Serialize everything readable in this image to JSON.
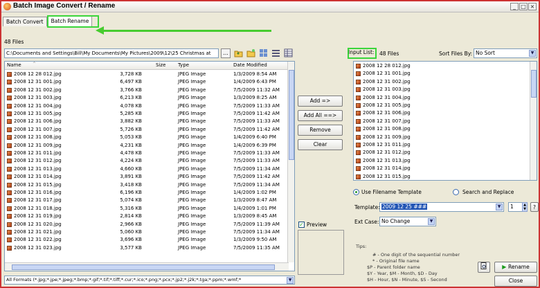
{
  "window": {
    "title": "Batch Image Convert / Rename",
    "controls": [
      "_",
      "□",
      "×"
    ]
  },
  "tabs": [
    {
      "label": "Batch Convert"
    },
    {
      "label": "Batch Rename"
    }
  ],
  "left": {
    "file_count": "48 Files",
    "path": "C:\\Documents and Settings\\Bill\\My Documents\\My Pictures\\2009\\12\\25 Christmas at",
    "browse_label": "...",
    "columns": {
      "name": "Name",
      "size": "Size",
      "type": "Type",
      "date": "Date Modified"
    },
    "rows": [
      {
        "name": "2008 12 28 012.jpg",
        "size": "3,728 KB",
        "type": "JPEG Image",
        "date": "1/3/2009 8:54 AM"
      },
      {
        "name": "2008 12 31 001.jpg",
        "size": "6,497 KB",
        "type": "JPEG Image",
        "date": "1/4/2009 6:43 PM"
      },
      {
        "name": "2008 12 31 002.jpg",
        "size": "3,766 KB",
        "type": "JPEG Image",
        "date": "7/5/2009 11:32 AM"
      },
      {
        "name": "2008 12 31 003.jpg",
        "size": "6,213 KB",
        "type": "JPEG Image",
        "date": "1/3/2009 8:25 AM"
      },
      {
        "name": "2008 12 31 004.jpg",
        "size": "4,078 KB",
        "type": "JPEG Image",
        "date": "7/5/2009 11:33 AM"
      },
      {
        "name": "2008 12 31 005.jpg",
        "size": "5,285 KB",
        "type": "JPEG Image",
        "date": "7/5/2009 11:42 AM"
      },
      {
        "name": "2008 12 31 006.jpg",
        "size": "3,882 KB",
        "type": "JPEG Image",
        "date": "7/5/2009 11:33 AM"
      },
      {
        "name": "2008 12 31 007.jpg",
        "size": "5,726 KB",
        "type": "JPEG Image",
        "date": "7/5/2009 11:42 AM"
      },
      {
        "name": "2008 12 31 008.jpg",
        "size": "5,053 KB",
        "type": "JPEG Image",
        "date": "1/4/2009 6:40 PM"
      },
      {
        "name": "2008 12 31 009.jpg",
        "size": "4,231 KB",
        "type": "JPEG Image",
        "date": "1/4/2009 6:39 PM"
      },
      {
        "name": "2008 12 31 011.jpg",
        "size": "4,478 KB",
        "type": "JPEG Image",
        "date": "7/5/2009 11:33 AM"
      },
      {
        "name": "2008 12 31 012.jpg",
        "size": "4,224 KB",
        "type": "JPEG Image",
        "date": "7/5/2009 11:33 AM"
      },
      {
        "name": "2008 12 31 013.jpg",
        "size": "4,660 KB",
        "type": "JPEG Image",
        "date": "7/5/2009 11:34 AM"
      },
      {
        "name": "2008 12 31 014.jpg",
        "size": "3,891 KB",
        "type": "JPEG Image",
        "date": "7/5/2009 11:42 AM"
      },
      {
        "name": "2008 12 31 015.jpg",
        "size": "3,418 KB",
        "type": "JPEG Image",
        "date": "7/5/2009 11:34 AM"
      },
      {
        "name": "2008 12 31 016.jpg",
        "size": "6,196 KB",
        "type": "JPEG Image",
        "date": "1/4/2009 1:02 PM"
      },
      {
        "name": "2008 12 31 017.jpg",
        "size": "5,074 KB",
        "type": "JPEG Image",
        "date": "1/3/2009 8:47 AM"
      },
      {
        "name": "2008 12 31 018.jpg",
        "size": "5,316 KB",
        "type": "JPEG Image",
        "date": "1/4/2009 1:01 PM"
      },
      {
        "name": "2008 12 31 019.jpg",
        "size": "2,814 KB",
        "type": "JPEG Image",
        "date": "1/3/2009 8:45 AM"
      },
      {
        "name": "2008 12 31 020.jpg",
        "size": "2,966 KB",
        "type": "JPEG Image",
        "date": "7/5/2009 11:39 AM"
      },
      {
        "name": "2008 12 31 021.jpg",
        "size": "5,060 KB",
        "type": "JPEG Image",
        "date": "7/5/2009 11:34 AM"
      },
      {
        "name": "2008 12 31 022.jpg",
        "size": "3,696 KB",
        "type": "JPEG Image",
        "date": "1/3/2009 9:50 AM"
      },
      {
        "name": "2008 12 31 023.jpg",
        "size": "3,577 KB",
        "type": "JPEG Image",
        "date": "7/5/2009 11:35 AM"
      }
    ],
    "format_filter": "All Formats (*.jpg;*.jpe;*.jpeg;*.bmp;*.gif;*.tif;*.tiff;*.cur;*.ico;*.png;*.pcx;*.jp2;*.j2k;*.tga;*.ppm;*.wmf;*"
  },
  "buttons": {
    "add": "Add =>",
    "add_all": "Add All ==>",
    "remove": "Remove",
    "clear": "Clear",
    "rename": "Rename",
    "close": "Close"
  },
  "right": {
    "input_list_label": "Input List:",
    "file_count": "48 Files",
    "sort_label": "Sort Files By:",
    "sort_value": "No Sort",
    "files": [
      "2008 12 28 012.jpg",
      "2008 12 31 001.jpg",
      "2008 12 31 002.jpg",
      "2008 12 31 003.jpg",
      "2008 12 31 004.jpg",
      "2008 12 31 005.jpg",
      "2008 12 31 006.jpg",
      "2008 12 31 007.jpg",
      "2008 12 31 008.jpg",
      "2008 12 31 009.jpg",
      "2008 12 31 011.jpg",
      "2008 12 31 012.jpg",
      "2008 12 31 013.jpg",
      "2008 12 31 014.jpg",
      "2008 12 31 015.jpg"
    ],
    "use_template": "Use Filename Template",
    "search_replace": "Search and Replace",
    "template_label": "Template:",
    "template_value": "2009 12 25 ###",
    "start_number": "1",
    "help": "?",
    "ext_case_label": "Ext Case:",
    "ext_case_value": "No Change",
    "preview_label": "Preview",
    "tips_title": "Tips:",
    "tips": [
      "#  - One digit of the sequential number",
      "*  - Original file name",
      "$P - Parent folder name",
      "$Y - Year,    $M - Month,     $D - Day",
      "$H - Hour,    $N - Minute,    $S - Second"
    ]
  },
  "colors": {
    "highlight": "#3bd53b",
    "arrow": "#47cc2f",
    "selection": "#2356b5"
  }
}
